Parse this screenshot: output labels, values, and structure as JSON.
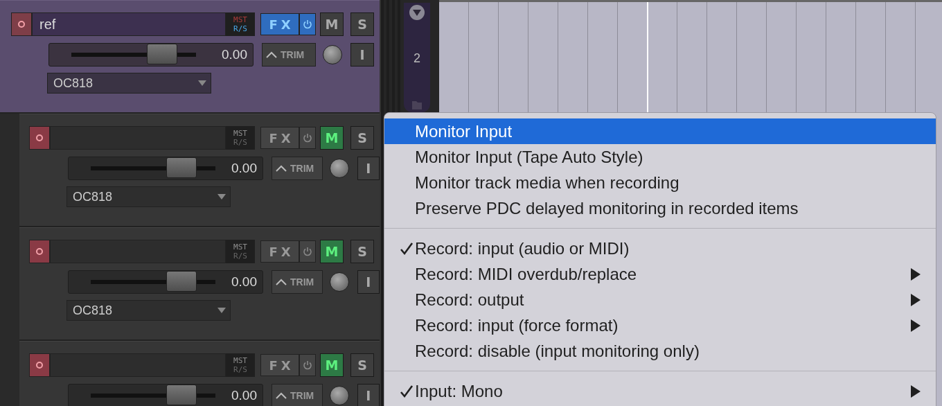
{
  "tracks": [
    {
      "name": "ref",
      "selected": true,
      "fx_on": true,
      "muted": false,
      "volume": "0.00",
      "level": 0.73,
      "input": "OC818",
      "mst": "MST",
      "rs": "R/S",
      "fx": "FX",
      "mute_label": "M",
      "solo_label": "S",
      "trim": "TRIM",
      "input_label": "I",
      "folder_number": "2",
      "children": [
        {
          "selected": false,
          "fx_on": false,
          "muted": true,
          "volume": "0.00",
          "level": 0.73,
          "input": "OC818",
          "mst": "MST",
          "rs": "R/S",
          "fx": "FX",
          "mute_label": "M",
          "solo_label": "S",
          "trim": "TRIM",
          "input_label": "I"
        },
        {
          "selected": false,
          "fx_on": false,
          "muted": true,
          "volume": "0.00",
          "level": 0.73,
          "input": "OC818",
          "mst": "MST",
          "rs": "R/S",
          "fx": "FX",
          "mute_label": "M",
          "solo_label": "S",
          "trim": "TRIM",
          "input_label": "I"
        },
        {
          "selected": false,
          "fx_on": false,
          "muted": true,
          "volume": "0.00",
          "level": 0.73,
          "mst": "MST",
          "rs": "R/S",
          "fx": "FX",
          "mute_label": "M",
          "solo_label": "S",
          "trim": "TRIM",
          "input_label": "I"
        }
      ]
    }
  ],
  "context_menu": [
    {
      "kind": "item",
      "label": "Monitor Input",
      "selected": true,
      "checked": false,
      "submenu": false
    },
    {
      "kind": "item",
      "label": "Monitor Input (Tape Auto Style)",
      "selected": false,
      "checked": false,
      "submenu": false
    },
    {
      "kind": "item",
      "label": "Monitor track media when recording",
      "selected": false,
      "checked": false,
      "submenu": false
    },
    {
      "kind": "item",
      "label": "Preserve PDC delayed monitoring in recorded items",
      "selected": false,
      "checked": false,
      "submenu": false
    },
    {
      "kind": "separator"
    },
    {
      "kind": "item",
      "label": "Record: input (audio or MIDI)",
      "selected": false,
      "checked": true,
      "submenu": false
    },
    {
      "kind": "item",
      "label": "Record: MIDI overdub/replace",
      "selected": false,
      "checked": false,
      "submenu": true
    },
    {
      "kind": "item",
      "label": "Record: output",
      "selected": false,
      "checked": false,
      "submenu": true
    },
    {
      "kind": "item",
      "label": "Record: input (force format)",
      "selected": false,
      "checked": false,
      "submenu": true
    },
    {
      "kind": "item",
      "label": "Record: disable (input monitoring only)",
      "selected": false,
      "checked": false,
      "submenu": false
    },
    {
      "kind": "separator"
    },
    {
      "kind": "item",
      "label": "Input: Mono",
      "selected": false,
      "checked": true,
      "submenu": true
    }
  ]
}
